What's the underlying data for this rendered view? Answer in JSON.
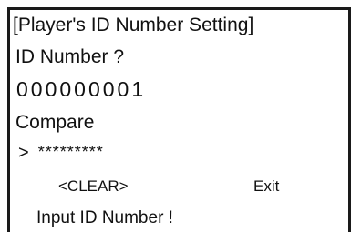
{
  "screen": {
    "title": "[Player's ID Number Setting]",
    "id_prompt": "ID Number ?",
    "id_value": "000000001",
    "compare_label": "Compare",
    "input_cursor": ">",
    "masked_input": "*********",
    "clear_label": "<CLEAR>",
    "exit_label": "Exit",
    "status_message": "Input ID Number !"
  }
}
